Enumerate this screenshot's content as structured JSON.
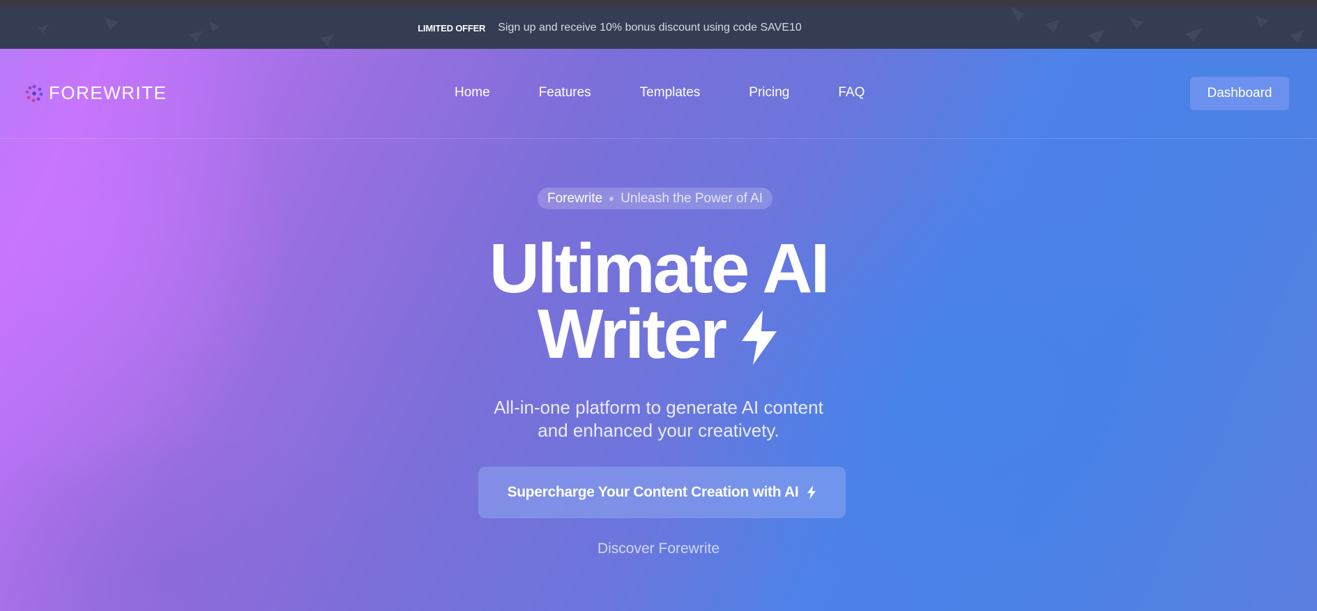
{
  "promo": {
    "badge": "LIMITED OFFER",
    "text": "Sign up and receive 10% bonus discount using code SAVE10"
  },
  "nav": {
    "logo_text": "FOREWRITE",
    "links": [
      "Home",
      "Features",
      "Templates",
      "Pricing",
      "FAQ"
    ],
    "dashboard_label": "Dashboard"
  },
  "hero": {
    "pill_brand": "Forewrite",
    "pill_tagline": "Unleash the Power of AI",
    "title_line1": "Ultimate AI",
    "title_line2": "Writer",
    "subtitle_line1": "All-in-one platform to generate AI content",
    "subtitle_line2": "and enhanced your creativety.",
    "cta_label": "Supercharge Your Content Creation with AI",
    "discover_label": "Discover Forewrite"
  },
  "icons": {
    "logo": "logo-dots-icon",
    "bolt": "lightning-bolt-icon"
  },
  "colors": {
    "promo_bg": "#353d55",
    "gradient_left": "#c474fb",
    "gradient_right": "#4a82e6",
    "text": "#ffffff"
  }
}
